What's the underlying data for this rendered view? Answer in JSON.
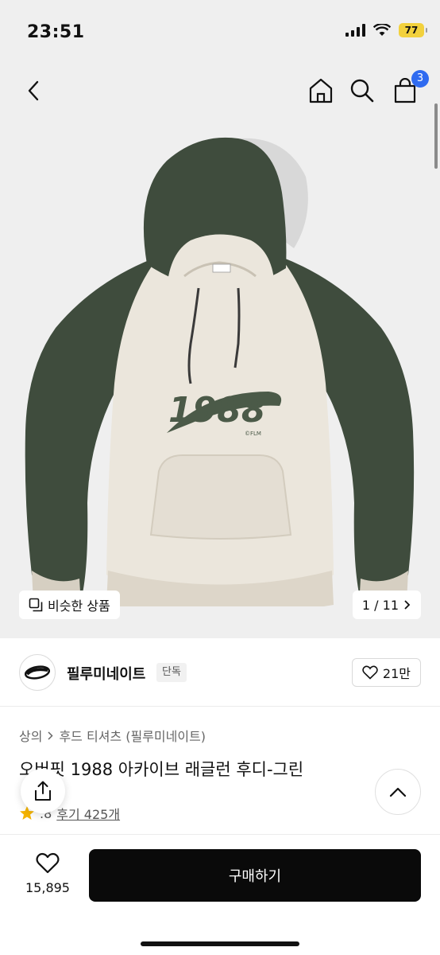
{
  "status_bar": {
    "time": "23:51",
    "battery": "77",
    "icons": [
      "signal-icon",
      "wifi-icon",
      "battery-icon"
    ]
  },
  "header": {
    "icons": [
      "back-icon",
      "home-icon",
      "search-icon",
      "cart-icon"
    ],
    "cart_badge": "3"
  },
  "gallery": {
    "similar_label": "비슷한 상품",
    "page_indicator": "1 / 11",
    "print_text": "1988",
    "print_subtext": "©FLM"
  },
  "brand": {
    "name": "필루미네이트",
    "tag": "단독",
    "like_count": "21만"
  },
  "product": {
    "breadcrumb": [
      "상의",
      "후드 티셔츠 (필루미네이트)"
    ],
    "title": "오버핏 1988 아카이브 래글런 후디-그린",
    "rating": ".8",
    "reviews": "후기 425개"
  },
  "bottom_bar": {
    "wish_count": "15,895",
    "buy_label": "구매하기"
  },
  "colors": {
    "hoodie_green": "#3f4c3d",
    "hoodie_body": "#ebe6dc",
    "badge_blue": "#2f6bf0",
    "star": "#f5b400",
    "buy_button": "#0a0a0a"
  }
}
